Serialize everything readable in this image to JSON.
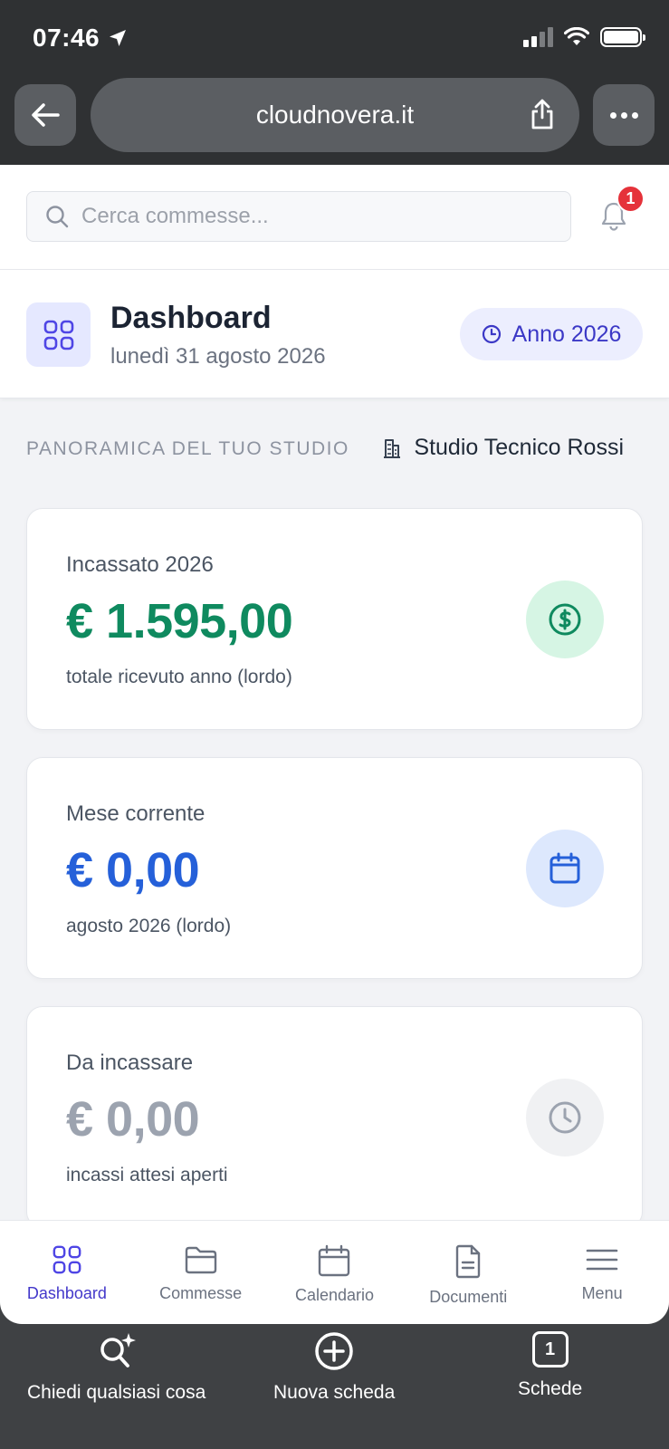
{
  "status_bar": {
    "time": "07:46"
  },
  "browser": {
    "url": "cloudnovera.it"
  },
  "search": {
    "placeholder": "Cerca commesse..."
  },
  "notifications": {
    "count": "1"
  },
  "header": {
    "title": "Dashboard",
    "date": "lunedì 31 agosto 2026",
    "year_button": "Anno 2026"
  },
  "overview": {
    "label": "PANORAMICA DEL TUO STUDIO",
    "studio_name": "Studio Tecnico Rossi"
  },
  "cards": [
    {
      "label": "Incassato 2026",
      "value": "€ 1.595,00",
      "note": "totale ricevuto anno (lordo)",
      "color": "#0f8a5f",
      "icon_bg": "#d6f5e4",
      "icon": "dollar-icon"
    },
    {
      "label": "Mese corrente",
      "value": "€ 0,00",
      "note": "agosto 2026 (lordo)",
      "color": "#2560d9",
      "icon_bg": "#dde8fd",
      "icon": "calendar-icon"
    },
    {
      "label": "Da incassare",
      "value": "€ 0,00",
      "note": "incassi attesi aperti",
      "color": "#9ca3af",
      "icon_bg": "#f0f1f3",
      "icon": "clock-icon"
    }
  ],
  "tabs": [
    {
      "label": "Dashboard",
      "icon": "grid-icon",
      "active": true
    },
    {
      "label": "Commesse",
      "icon": "folder-icon"
    },
    {
      "label": "Calendario",
      "icon": "calendar-icon"
    },
    {
      "label": "Documenti",
      "icon": "document-icon"
    },
    {
      "label": "Menu",
      "icon": "menu-icon"
    }
  ],
  "safari_toolbar": {
    "ask": "Chiedi qualsiasi cosa",
    "new_tab": "Nuova scheda",
    "tabs": "Schede",
    "tab_count": "1"
  }
}
